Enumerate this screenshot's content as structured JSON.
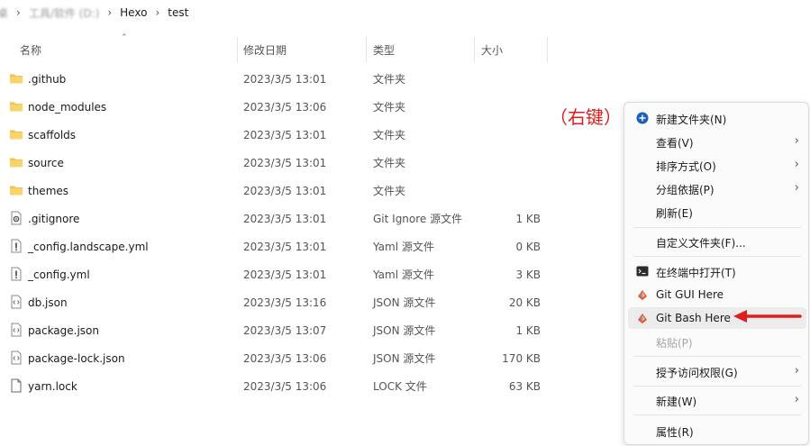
{
  "breadcrumb": {
    "blurred": [
      "桌",
      "工具/软件 (D:)"
    ],
    "items": [
      "Hexo",
      "test"
    ],
    "separator": "›"
  },
  "columns": {
    "name": "名称",
    "date": "修改日期",
    "type": "类型",
    "size": "大小"
  },
  "files": [
    {
      "name": ".github",
      "date": "2023/3/5 13:01",
      "type": "文件夹",
      "size": "",
      "icon": "folder-icon"
    },
    {
      "name": "node_modules",
      "date": "2023/3/5 13:06",
      "type": "文件夹",
      "size": "",
      "icon": "folder-icon"
    },
    {
      "name": "scaffolds",
      "date": "2023/3/5 13:01",
      "type": "文件夹",
      "size": "",
      "icon": "folder-icon"
    },
    {
      "name": "source",
      "date": "2023/3/5 13:01",
      "type": "文件夹",
      "size": "",
      "icon": "folder-icon"
    },
    {
      "name": "themes",
      "date": "2023/3/5 13:01",
      "type": "文件夹",
      "size": "",
      "icon": "folder-icon"
    },
    {
      "name": ".gitignore",
      "date": "2023/3/5 13:01",
      "type": "Git Ignore 源文件",
      "size": "1 KB",
      "icon": "gear-file-icon"
    },
    {
      "name": "_config.landscape.yml",
      "date": "2023/3/5 13:01",
      "type": "Yaml 源文件",
      "size": "0 KB",
      "icon": "exclamation-file-icon"
    },
    {
      "name": "_config.yml",
      "date": "2023/3/5 13:01",
      "type": "Yaml 源文件",
      "size": "3 KB",
      "icon": "exclamation-file-icon"
    },
    {
      "name": "db.json",
      "date": "2023/3/5 13:16",
      "type": "JSON 源文件",
      "size": "20 KB",
      "icon": "code-file-icon"
    },
    {
      "name": "package.json",
      "date": "2023/3/5 13:07",
      "type": "JSON 源文件",
      "size": "1 KB",
      "icon": "code-file-icon"
    },
    {
      "name": "package-lock.json",
      "date": "2023/3/5 13:06",
      "type": "JSON 源文件",
      "size": "170 KB",
      "icon": "code-file-icon"
    },
    {
      "name": "yarn.lock",
      "date": "2023/3/5 13:06",
      "type": "LOCK 文件",
      "size": "63 KB",
      "icon": "blank-file-icon"
    }
  ],
  "annotation": "（右键）",
  "menu": {
    "items": [
      {
        "label": "新建文件夹(N)",
        "icon": "new-folder-icon"
      },
      {
        "label": "查看(V)",
        "submenu": true
      },
      {
        "label": "排序方式(O)",
        "submenu": true
      },
      {
        "label": "分组依据(P)",
        "submenu": true
      },
      {
        "label": "刷新(E)"
      },
      {
        "label": "自定义文件夹(F)..."
      },
      {
        "label": "在终端中打开(T)",
        "icon": "terminal-icon"
      },
      {
        "label": "Git GUI Here",
        "icon": "git-icon"
      },
      {
        "label": "Git Bash Here",
        "icon": "git-icon",
        "highlighted": true
      },
      {
        "label": "粘贴(P)",
        "disabled": true
      },
      {
        "label": "授予访问权限(G)",
        "submenu": true
      },
      {
        "label": "新建(W)",
        "submenu": true
      },
      {
        "label": "属性(R)"
      }
    ]
  },
  "colors": {
    "folder": "#f4c24a",
    "accent_red": "#e01e1e",
    "highlight": "#ececec",
    "menu_bg": "#fbfbfb"
  }
}
